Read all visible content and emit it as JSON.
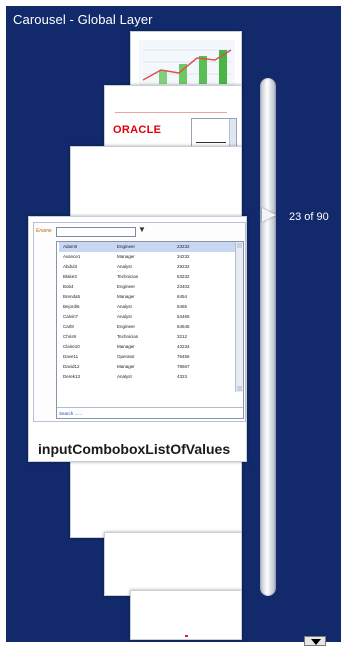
{
  "window": {
    "title": "Carousel - Global Layer"
  },
  "carousel": {
    "counter": "23 of 90",
    "current_item_caption": "inputComboboxListOfValues"
  },
  "thumbnails": {
    "oracle_logo": "ORACLE"
  },
  "lov": {
    "field_label": "Ename",
    "rows": [
      {
        "name": "Adam0",
        "job": "Engineer",
        "value": "23232"
      },
      {
        "name": "Avance1",
        "job": "Manager",
        "value": "34232"
      },
      {
        "name": "Abdul3",
        "job": "Analyst",
        "value": "29232"
      },
      {
        "name": "Blake3",
        "job": "Technician",
        "value": "53232"
      },
      {
        "name": "Bob4",
        "job": "Engineer",
        "value": "23402"
      },
      {
        "name": "Brenda5",
        "job": "Manager",
        "value": "6454"
      },
      {
        "name": "Bejordi6",
        "job": "Analyst",
        "value": "5455"
      },
      {
        "name": "Calvin7",
        "job": "Analyst",
        "value": "54465"
      },
      {
        "name": "Carl8",
        "job": "Engineer",
        "value": "64545"
      },
      {
        "name": "Chris9",
        "job": "Technician",
        "value": "3212"
      },
      {
        "name": "Claire10",
        "job": "Manager",
        "value": "43234"
      },
      {
        "name": "Dave11",
        "job": "Operator",
        "value": "76456"
      },
      {
        "name": "David12",
        "job": "Manager",
        "value": "78667"
      },
      {
        "name": "Derek13",
        "job": "Analyst",
        "value": "4323"
      }
    ],
    "search_link": "Search ......"
  },
  "colors": {
    "background": "#122a6b",
    "accent_red": "#e0000f"
  }
}
